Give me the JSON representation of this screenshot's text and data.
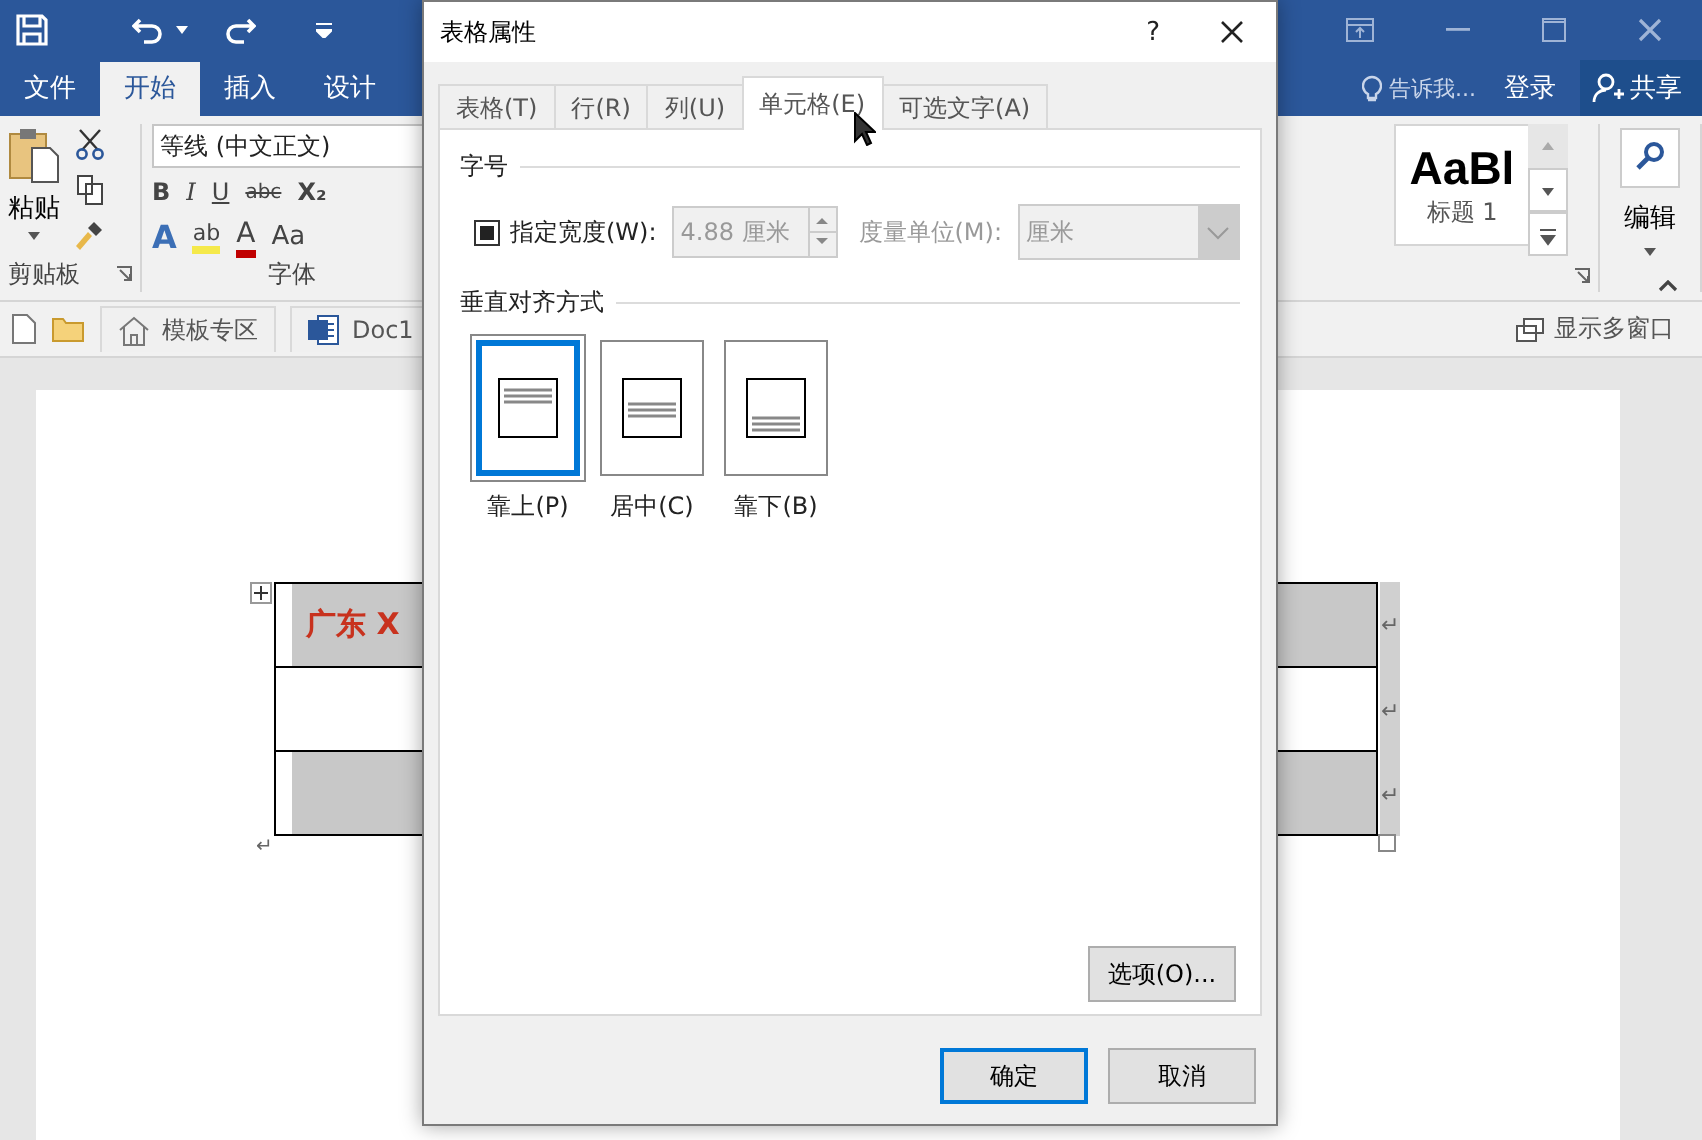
{
  "word": {
    "tabs": [
      {
        "label": "文件",
        "selected": false
      },
      {
        "label": "开始",
        "selected": true
      },
      {
        "label": "插入",
        "selected": false
      },
      {
        "label": "设计",
        "selected": false
      }
    ],
    "tell_me": "告诉我...",
    "sign_in": "登录",
    "share": "共享",
    "clipboard": {
      "paste": "粘贴",
      "group": "剪贴板"
    },
    "font": {
      "name": "等线 (中文正文)",
      "group": "字体",
      "row1": [
        "B",
        "I",
        "U",
        "abc",
        "X₂"
      ],
      "row2": [
        "A",
        "ab",
        "A",
        "Aa"
      ]
    },
    "styles": {
      "sample": "AaBl",
      "name": "标题 1"
    },
    "editing": "编辑",
    "doc_tabs": [
      {
        "label": "模板专区",
        "kind": "home"
      },
      {
        "label": "Doc1",
        "kind": "word"
      }
    ],
    "multi_window": "显示多窗口",
    "table": {
      "rows": [
        {
          "text": "广东 X",
          "shaded": true,
          "end_mark": "↵"
        },
        {
          "shaded": false,
          "end_mark": "↵"
        },
        {
          "shaded": true,
          "end_mark": "↵"
        }
      ],
      "after_mark": "↵"
    }
  },
  "dialog": {
    "title": "表格属性",
    "help": "?",
    "tabs": [
      {
        "label": "表格(T)",
        "selected": false
      },
      {
        "label": "行(R)",
        "selected": false
      },
      {
        "label": "列(U)",
        "selected": false
      },
      {
        "label": "单元格(E)",
        "selected": true
      },
      {
        "label": "可选文字(A)",
        "selected": false
      }
    ],
    "size_section": "字号",
    "width_check": {
      "label": "指定宽度(W):",
      "checked": true
    },
    "width_value": "4.88 厘米",
    "unit_label": "度量单位(M):",
    "unit_value": "厘米",
    "fields_disabled": true,
    "align_section": "垂直对齐方式",
    "align_options": [
      {
        "label": "靠上(P)",
        "kind": "top",
        "selected": true
      },
      {
        "label": "居中(C)",
        "kind": "center",
        "selected": false
      },
      {
        "label": "靠下(B)",
        "kind": "bottom",
        "selected": false
      }
    ],
    "options_button": "选项(O)...",
    "ok": "确定",
    "cancel": "取消"
  }
}
